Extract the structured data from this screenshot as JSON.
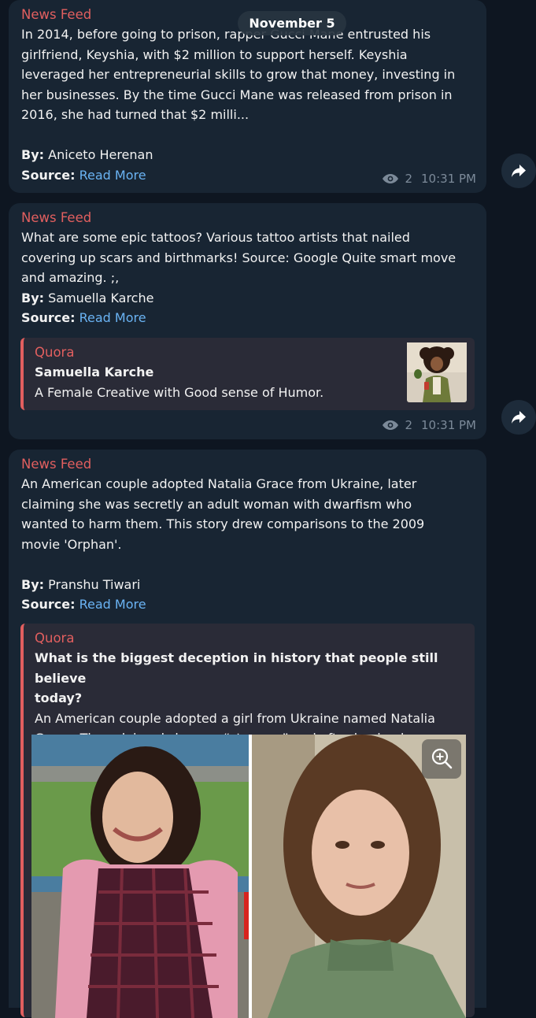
{
  "date_separator": "November 5",
  "posts": [
    {
      "sender": "News Feed",
      "text_lines": [
        "In 2014, before going to prison, rapper Gucci Mane entrusted his",
        "girlfriend, Keyshia, with $2 million to support herself. Keyshia",
        "leveraged her entrepreneurial skills to grow that money, investing in",
        "her businesses. By the time Gucci Mane was released from prison in",
        "2016, she had turned that $2 milli..."
      ],
      "by_label": "By:",
      "author": "Aniceto Herenan",
      "source_label": "Source:",
      "source_link": "Read More",
      "views": "2",
      "time": "10:31 PM"
    },
    {
      "sender": "News Feed",
      "text_lines": [
        "What are some epic tattoos? Various tattoo artists that nailed",
        "covering up scars and birthmarks! Source: Google Quite smart move",
        "and amazing. ;,"
      ],
      "by_label": "By:",
      "author": "Samuella Karche",
      "source_label": "Source:",
      "source_link": "Read More",
      "preview": {
        "site": "Quora",
        "title": "Samuella Karche",
        "description": "A Female Creative with Good sense of Humor."
      },
      "views": "2",
      "time": "10:31 PM"
    },
    {
      "sender": "News Feed",
      "text_lines": [
        "An American couple adopted Natalia Grace from Ukraine, later",
        "claiming she was secretly an adult woman with dwarfism who",
        "wanted to harm them. This story drew comparisons to the 2009",
        "movie 'Orphan'."
      ],
      "by_label": "By:",
      "author": "Pranshu Tiwari",
      "source_label": "Source:",
      "source_link": "Read More",
      "preview": {
        "site": "Quora",
        "title_lines": [
          "What is the biggest deception in history that people still believe",
          "today?"
        ],
        "description_lines": [
          "An American couple adopted a girl from Ukraine named Natalia",
          "Grace. They claimed she was “strange,” and after having her “exa..."
        ]
      }
    }
  ],
  "colors": {
    "background": "#0e1621",
    "bubble": "#182533",
    "accent": "#e25f5f",
    "link": "#6ab3f3",
    "meta": "#7c8a99"
  },
  "icons": [
    "eye-icon",
    "share-arrow-icon",
    "zoom-in-icon"
  ]
}
